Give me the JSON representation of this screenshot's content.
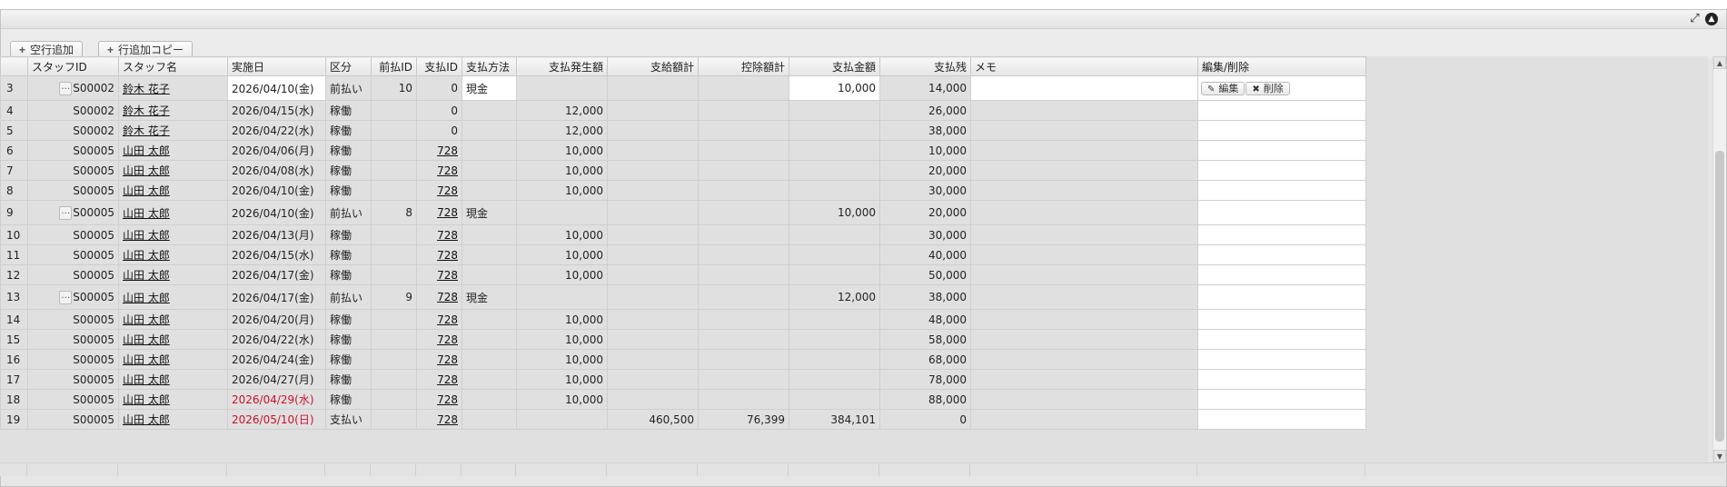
{
  "toolbar": {
    "add_empty_row": "空行追加",
    "add_row_copy": "行追加コピー"
  },
  "headers": [
    "",
    "スタッフID",
    "スタッフ名",
    "実施日",
    "区分",
    "前払ID",
    "支払ID",
    "支払方法",
    "支払発生額",
    "支給額計",
    "控除額計",
    "支払金額",
    "支払残",
    "メモ",
    "編集/削除"
  ],
  "row_buttons": {
    "edit": "編集",
    "delete": "削除"
  },
  "rows": [
    {
      "no": "3",
      "staff_id": "S00002",
      "name": "鈴木 花子",
      "date": "2026/04/10(金)",
      "kubun": "前払い",
      "prepay_id": "10",
      "pay_id": "0",
      "method": "現金",
      "occur": "",
      "pay_total": "",
      "deduct": "",
      "amount": "10,000",
      "balance": "14,000",
      "memo": "",
      "editing": true,
      "has_dots": true
    },
    {
      "no": "4",
      "staff_id": "S00002",
      "name": "鈴木 花子",
      "date": "2026/04/15(水)",
      "kubun": "稼働",
      "prepay_id": "",
      "pay_id": "0",
      "method": "",
      "occur": "12,000",
      "pay_total": "",
      "deduct": "",
      "amount": "",
      "balance": "26,000",
      "memo": ""
    },
    {
      "no": "5",
      "staff_id": "S00002",
      "name": "鈴木 花子",
      "date": "2026/04/22(水)",
      "kubun": "稼働",
      "prepay_id": "",
      "pay_id": "0",
      "method": "",
      "occur": "12,000",
      "pay_total": "",
      "deduct": "",
      "amount": "",
      "balance": "38,000",
      "memo": ""
    },
    {
      "no": "6",
      "staff_id": "S00005",
      "name": "山田 太郎",
      "date": "2026/04/06(月)",
      "kubun": "稼働",
      "prepay_id": "",
      "pay_id": "728",
      "method": "",
      "occur": "10,000",
      "pay_total": "",
      "deduct": "",
      "amount": "",
      "balance": "10,000",
      "memo": ""
    },
    {
      "no": "7",
      "staff_id": "S00005",
      "name": "山田 太郎",
      "date": "2026/04/08(水)",
      "kubun": "稼働",
      "prepay_id": "",
      "pay_id": "728",
      "method": "",
      "occur": "10,000",
      "pay_total": "",
      "deduct": "",
      "amount": "",
      "balance": "20,000",
      "memo": ""
    },
    {
      "no": "8",
      "staff_id": "S00005",
      "name": "山田 太郎",
      "date": "2026/04/10(金)",
      "kubun": "稼働",
      "prepay_id": "",
      "pay_id": "728",
      "method": "",
      "occur": "10,000",
      "pay_total": "",
      "deduct": "",
      "amount": "",
      "balance": "30,000",
      "memo": ""
    },
    {
      "no": "9",
      "staff_id": "S00005",
      "name": "山田 太郎",
      "date": "2026/04/10(金)",
      "kubun": "前払い",
      "prepay_id": "8",
      "pay_id": "728",
      "method": "現金",
      "occur": "",
      "pay_total": "",
      "deduct": "",
      "amount": "10,000",
      "balance": "20,000",
      "memo": "",
      "has_dots": true
    },
    {
      "no": "10",
      "staff_id": "S00005",
      "name": "山田 太郎",
      "date": "2026/04/13(月)",
      "kubun": "稼働",
      "prepay_id": "",
      "pay_id": "728",
      "method": "",
      "occur": "10,000",
      "pay_total": "",
      "deduct": "",
      "amount": "",
      "balance": "30,000",
      "memo": ""
    },
    {
      "no": "11",
      "staff_id": "S00005",
      "name": "山田 太郎",
      "date": "2026/04/15(水)",
      "kubun": "稼働",
      "prepay_id": "",
      "pay_id": "728",
      "method": "",
      "occur": "10,000",
      "pay_total": "",
      "deduct": "",
      "amount": "",
      "balance": "40,000",
      "memo": ""
    },
    {
      "no": "12",
      "staff_id": "S00005",
      "name": "山田 太郎",
      "date": "2026/04/17(金)",
      "kubun": "稼働",
      "prepay_id": "",
      "pay_id": "728",
      "method": "",
      "occur": "10,000",
      "pay_total": "",
      "deduct": "",
      "amount": "",
      "balance": "50,000",
      "memo": ""
    },
    {
      "no": "13",
      "staff_id": "S00005",
      "name": "山田 太郎",
      "date": "2026/04/17(金)",
      "kubun": "前払い",
      "prepay_id": "9",
      "pay_id": "728",
      "method": "現金",
      "occur": "",
      "pay_total": "",
      "deduct": "",
      "amount": "12,000",
      "balance": "38,000",
      "memo": "",
      "has_dots": true
    },
    {
      "no": "14",
      "staff_id": "S00005",
      "name": "山田 太郎",
      "date": "2026/04/20(月)",
      "kubun": "稼働",
      "prepay_id": "",
      "pay_id": "728",
      "method": "",
      "occur": "10,000",
      "pay_total": "",
      "deduct": "",
      "amount": "",
      "balance": "48,000",
      "memo": ""
    },
    {
      "no": "15",
      "staff_id": "S00005",
      "name": "山田 太郎",
      "date": "2026/04/22(水)",
      "kubun": "稼働",
      "prepay_id": "",
      "pay_id": "728",
      "method": "",
      "occur": "10,000",
      "pay_total": "",
      "deduct": "",
      "amount": "",
      "balance": "58,000",
      "memo": ""
    },
    {
      "no": "16",
      "staff_id": "S00005",
      "name": "山田 太郎",
      "date": "2026/04/24(金)",
      "kubun": "稼働",
      "prepay_id": "",
      "pay_id": "728",
      "method": "",
      "occur": "10,000",
      "pay_total": "",
      "deduct": "",
      "amount": "",
      "balance": "68,000",
      "memo": ""
    },
    {
      "no": "17",
      "staff_id": "S00005",
      "name": "山田 太郎",
      "date": "2026/04/27(月)",
      "kubun": "稼働",
      "prepay_id": "",
      "pay_id": "728",
      "method": "",
      "occur": "10,000",
      "pay_total": "",
      "deduct": "",
      "amount": "",
      "balance": "78,000",
      "memo": ""
    },
    {
      "no": "18",
      "staff_id": "S00005",
      "name": "山田 太郎",
      "date": "2026/04/29(水)",
      "kubun": "稼働",
      "prepay_id": "",
      "pay_id": "728",
      "method": "",
      "occur": "10,000",
      "pay_total": "",
      "deduct": "",
      "amount": "",
      "balance": "88,000",
      "memo": "",
      "date_red": true
    },
    {
      "no": "19",
      "staff_id": "S00005",
      "name": "山田 太郎",
      "date": "2026/05/10(日)",
      "kubun": "支払い",
      "prepay_id": "",
      "pay_id": "728",
      "method": "",
      "occur": "",
      "pay_total": "460,500",
      "deduct": "76,399",
      "amount": "384,101",
      "balance": "0",
      "memo": "",
      "date_red": true
    }
  ],
  "colors": {
    "holiday_red": "#c8102e",
    "cell_gray": "#e0e0e0"
  }
}
